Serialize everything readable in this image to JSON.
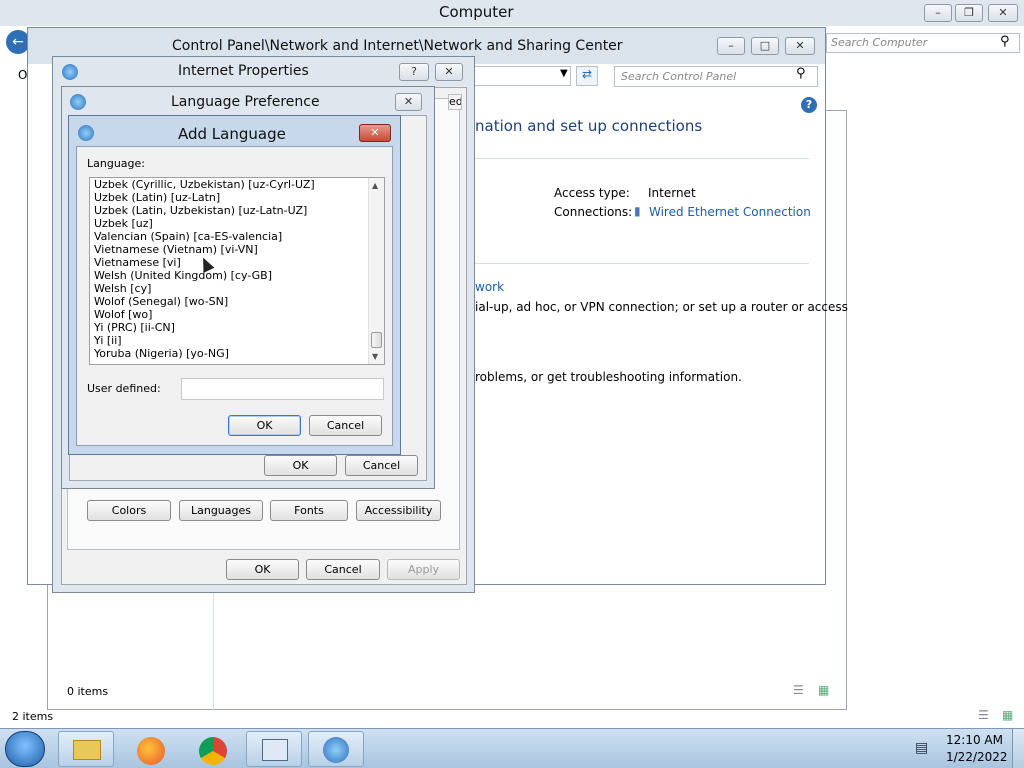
{
  "computer_window": {
    "title": "Computer",
    "search_placeholder": "Search Computer",
    "status_left": "2 items",
    "stub_label": "O"
  },
  "behind_window": {
    "status": "0 items"
  },
  "network_window": {
    "title": "Control Panel\\Network and Internet\\Network and Sharing Center",
    "search_placeholder": "Search Control Panel",
    "heading_partial": "nation and set up connections",
    "access_type_label": "Access type:",
    "access_type_value": "Internet",
    "connections_label": "Connections:",
    "connection_link": "Wired Ethernet Connection",
    "link_partial": "work",
    "text1": "ial-up, ad hoc, or VPN connection; or set up a router or access",
    "text2": "roblems, or get troubleshooting information.",
    "tab_partial": "ed"
  },
  "internet_properties": {
    "title": "Internet Properties",
    "help_glyph": "?",
    "buttons": {
      "colors": "Colors",
      "languages": "Languages",
      "fonts": "Fonts",
      "accessibility": "Accessibility",
      "ok": "OK",
      "cancel": "Cancel",
      "apply": "Apply"
    }
  },
  "language_preference": {
    "title": "Language Preference",
    "ok": "OK",
    "cancel": "Cancel"
  },
  "add_language": {
    "title": "Add Language",
    "language_label": "Language:",
    "languages": [
      "Uzbek (Cyrillic, Uzbekistan) [uz-Cyrl-UZ]",
      "Uzbek (Latin) [uz-Latn]",
      "Uzbek (Latin, Uzbekistan) [uz-Latn-UZ]",
      "Uzbek [uz]",
      "Valencian (Spain) [ca-ES-valencia]",
      "Vietnamese (Vietnam) [vi-VN]",
      "Vietnamese [vi]",
      "Welsh (United Kingdom) [cy-GB]",
      "Welsh [cy]",
      "Wolof (Senegal) [wo-SN]",
      "Wolof [wo]",
      "Yi (PRC) [ii-CN]",
      "Yi [ii]",
      "Yoruba (Nigeria) [yo-NG]"
    ],
    "user_defined_label": "User defined:",
    "user_defined_value": "",
    "ok": "OK",
    "cancel": "Cancel"
  },
  "taskbar": {
    "time": "12:10 AM",
    "date": "1/22/2022"
  },
  "colors": {
    "accent": "#1a5ea8",
    "close_red": "#c64a36"
  }
}
